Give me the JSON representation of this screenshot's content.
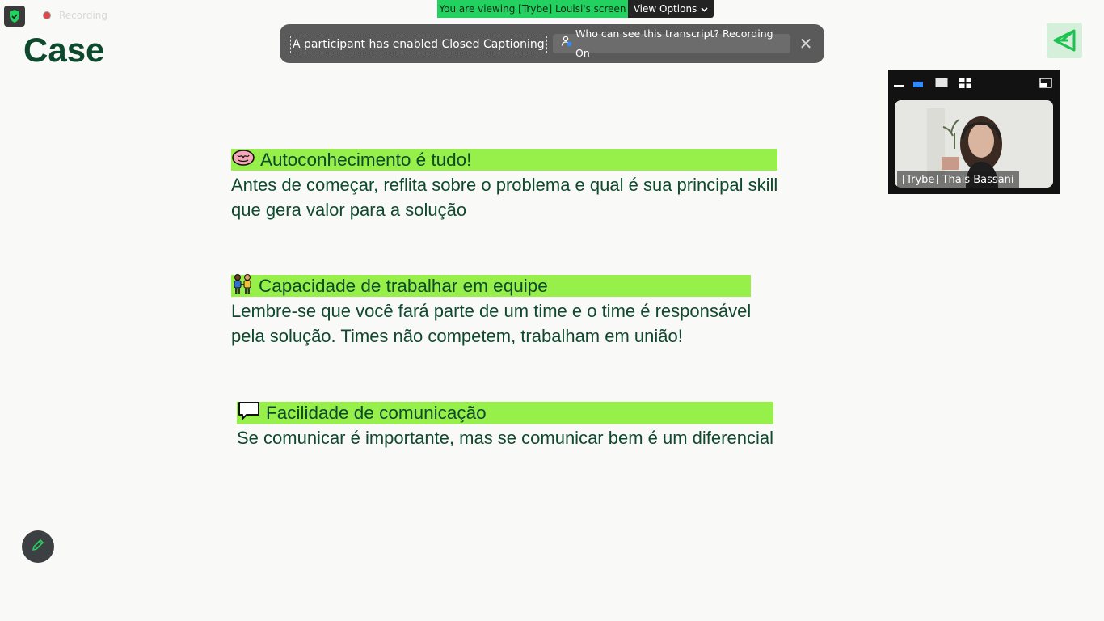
{
  "recording": {
    "label": "Recording"
  },
  "banner": {
    "viewing": "You are viewing [Trybe] Louisi's screen",
    "view_options": "View Options"
  },
  "caption_notice": {
    "text": "A participant has enabled Closed Captioning",
    "transcript_button": "Who can see this transcript? Recording On"
  },
  "slide": {
    "title": "Case",
    "sections": [
      {
        "icon": "brain-icon",
        "heading": "Autoconhecimento é tudo!",
        "lines": [
          "Antes de começar, reflita sobre o problema e qual é sua principal skill",
          "que gera valor para a solução"
        ]
      },
      {
        "icon": "people-holding-hands-icon",
        "heading": "Capacidade de trabalhar em equipe",
        "lines": [
          "Lembre-se que você fará parte de um time e o time é responsável",
          "pela solução. Times não competem, trabalham em união!"
        ]
      },
      {
        "icon": "speech-bubble-icon",
        "heading": "Facilidade de comunicação",
        "lines": [
          "Se comunicar é importante, mas se comunicar bem é um diferencial"
        ]
      }
    ]
  },
  "video": {
    "participant_name": "[Trybe] Thais Bassani"
  },
  "colors": {
    "highlight": "#97ef4a",
    "text": "#0f4a2e",
    "banner_green": "#23d160"
  }
}
